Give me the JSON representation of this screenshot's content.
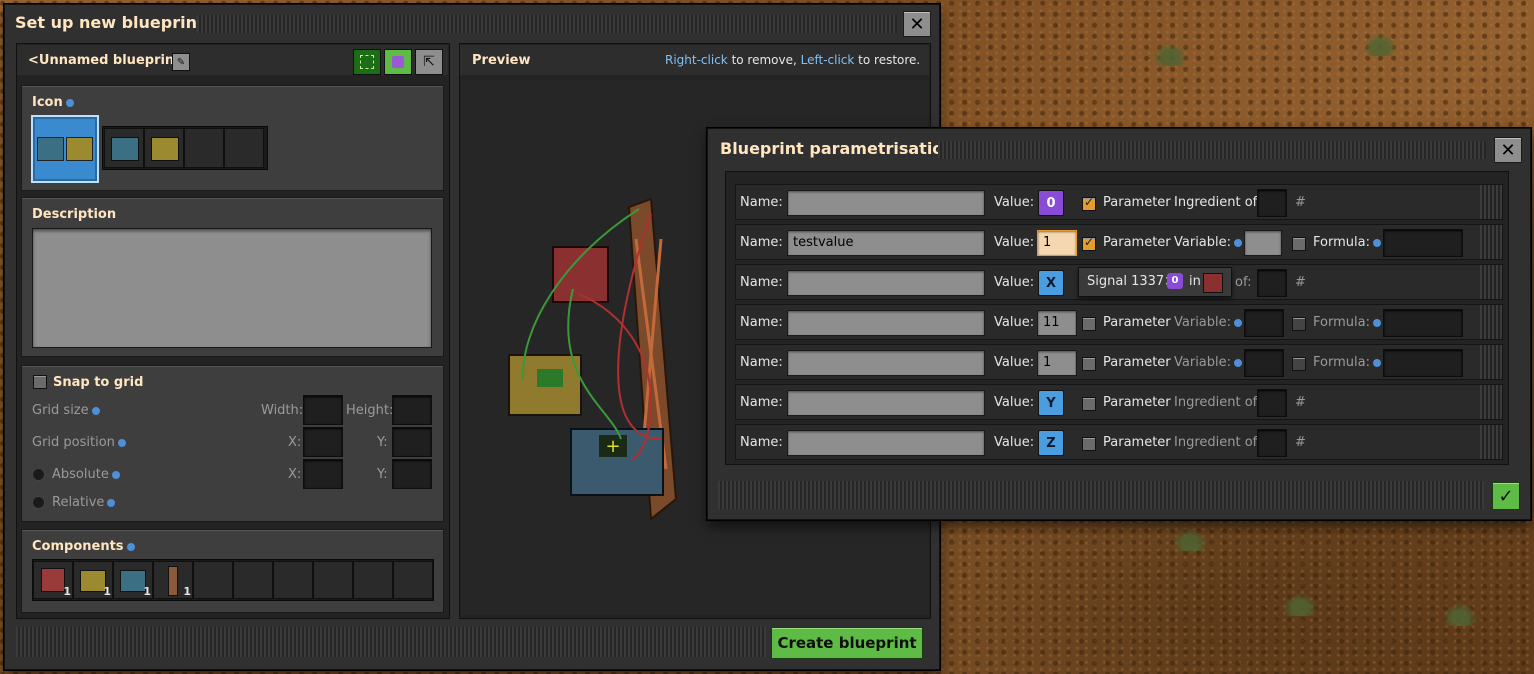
{
  "blueprint_window": {
    "title": "Set up new blueprint",
    "name": "<Unnamed blueprint>",
    "preview_label": "Preview",
    "hint_right_click": "Right-click",
    "hint_remove": " to remove, ",
    "hint_left_click": "Left-click",
    "hint_restore": " to restore.",
    "icon_label": "Icon",
    "description_label": "Description",
    "snap_to_grid": "Snap to grid",
    "grid_size": "Grid size",
    "width": "Width:",
    "height": "Height:",
    "grid_position": "Grid position",
    "x": "X:",
    "y": "Y:",
    "absolute": "Absolute",
    "relative": "Relative",
    "components_label": "Components",
    "components": [
      {
        "icon": "substation-icon",
        "count": "1"
      },
      {
        "icon": "decider-combinator-icon",
        "count": "1"
      },
      {
        "icon": "arithmetic-combinator-icon",
        "count": "1"
      },
      {
        "icon": "medium-pole-icon",
        "count": "1"
      }
    ],
    "create_button": "Create blueprint"
  },
  "param_window": {
    "title": "Blueprint parametrisation",
    "labels": {
      "name": "Name:",
      "value": "Value:",
      "parameter": "Parameter",
      "ingredient_of": "Ingredient of:",
      "variable": "Variable:",
      "formula": "Formula:",
      "hash": "#",
      "of": "of:"
    },
    "rows": [
      {
        "name": "",
        "value": "0",
        "value_kind": "purple-signal",
        "parameter": true,
        "mode": "ingredient"
      },
      {
        "name": "testvalue",
        "value": "1",
        "value_kind": "number-active",
        "parameter": true,
        "mode": "variable"
      },
      {
        "name": "",
        "value": "X",
        "value_kind": "letter-signal",
        "parameter": null,
        "mode": "tooltip",
        "tooltip_text": "Signal 1337×",
        "tooltip_in": "in"
      },
      {
        "name": "",
        "value": "11",
        "value_kind": "number",
        "parameter": false,
        "mode": "variable-dim"
      },
      {
        "name": "",
        "value": "1",
        "value_kind": "number",
        "parameter": false,
        "mode": "variable-dim"
      },
      {
        "name": "",
        "value": "Y",
        "value_kind": "letter-signal",
        "parameter": false,
        "mode": "ingredient-dim"
      },
      {
        "name": "",
        "value": "Z",
        "value_kind": "letter-signal",
        "parameter": false,
        "mode": "ingredient-dim"
      }
    ],
    "tooltip_signal_value": "0"
  },
  "colors": {
    "accent_green": "#5ebb45",
    "signal_blue": "#4a9ee0",
    "signal_purple": "#8a4bd6",
    "checkbox_orange": "#e59b2d"
  }
}
